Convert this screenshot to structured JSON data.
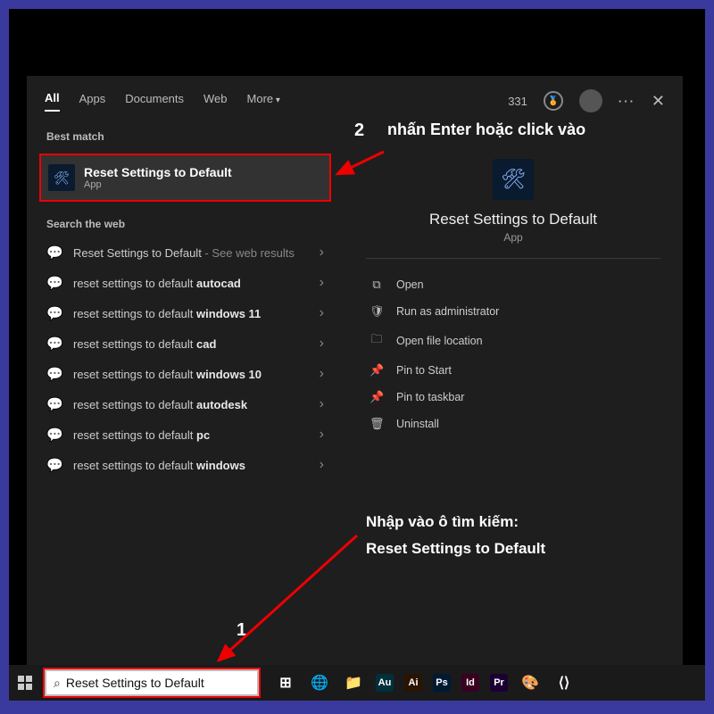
{
  "tabs": {
    "all": "All",
    "apps": "Apps",
    "documents": "Documents",
    "web": "Web",
    "more": "More"
  },
  "header": {
    "count": "331",
    "dots": "···",
    "close": "✕"
  },
  "sections": {
    "best": "Best match",
    "web": "Search the web"
  },
  "bestMatch": {
    "title": "Reset Settings to Default",
    "sub": "App"
  },
  "webResults": [
    {
      "prefix": "Reset Settings to Default",
      "suffix": " - See web results",
      "boldSuffix": ""
    },
    {
      "prefix": "reset settings to default ",
      "suffix": "",
      "boldSuffix": "autocad"
    },
    {
      "prefix": "reset settings to default ",
      "suffix": "",
      "boldSuffix": "windows 11"
    },
    {
      "prefix": "reset settings to default ",
      "suffix": "",
      "boldSuffix": "cad"
    },
    {
      "prefix": "reset settings to default ",
      "suffix": "",
      "boldSuffix": "windows 10"
    },
    {
      "prefix": "reset settings to default ",
      "suffix": "",
      "boldSuffix": "autodesk"
    },
    {
      "prefix": "reset settings to default ",
      "suffix": "",
      "boldSuffix": "pc"
    },
    {
      "prefix": "reset settings to default ",
      "suffix": "",
      "boldSuffix": "windows"
    }
  ],
  "preview": {
    "title": "Reset Settings to Default",
    "sub": "App"
  },
  "actions": {
    "open": "Open",
    "admin": "Run as administrator",
    "loc": "Open file location",
    "pinStart": "Pin to Start",
    "pinTask": "Pin to taskbar",
    "uninstall": "Uninstall"
  },
  "annotations": {
    "num1": "1",
    "num2": "2",
    "text2": "nhấn Enter hoặc click vào",
    "text1a": "Nhập vào ô tìm kiếm:",
    "text1b": "Reset Settings to Default"
  },
  "taskbar": {
    "searchValue": "Reset Settings to Default"
  },
  "taskApps": [
    {
      "label": "",
      "bg": "transparent",
      "glyph": "⊞"
    },
    {
      "label": "",
      "bg": "transparent",
      "glyph": "🌐"
    },
    {
      "label": "",
      "bg": "transparent",
      "glyph": "📁"
    },
    {
      "label": "Au",
      "bg": "#00303a"
    },
    {
      "label": "Ai",
      "bg": "#2a1400"
    },
    {
      "label": "Ps",
      "bg": "#001a33"
    },
    {
      "label": "Id",
      "bg": "#3a0020"
    },
    {
      "label": "Pr",
      "bg": "#1a0033"
    },
    {
      "label": "",
      "bg": "transparent",
      "glyph": "🎨"
    },
    {
      "label": "",
      "bg": "transparent",
      "glyph": "⟨⟩"
    }
  ]
}
